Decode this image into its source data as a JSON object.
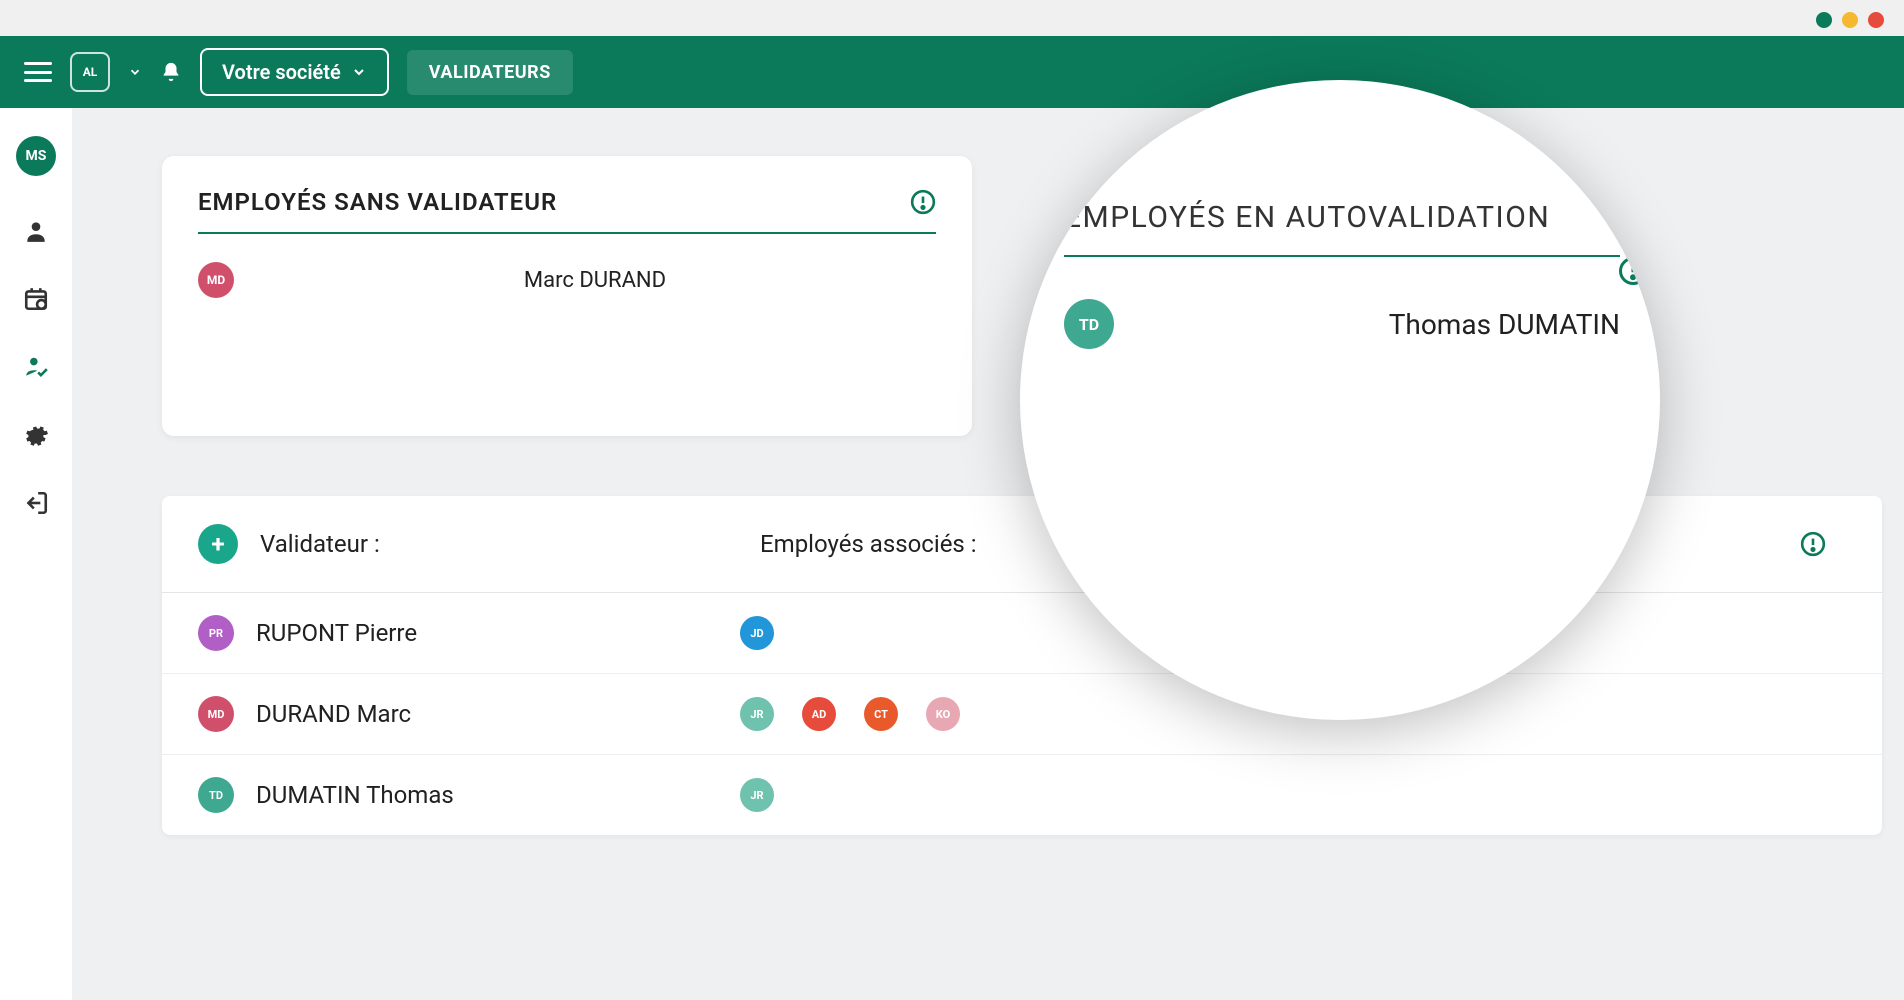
{
  "window": {
    "controls": [
      "green",
      "yellow",
      "red"
    ]
  },
  "topbar": {
    "logo": "AL",
    "company_label": "Votre société",
    "tab_label": "VALIDATEURS"
  },
  "sidebar": {
    "user_avatar": "MS"
  },
  "cards": {
    "no_validator": {
      "title": "EMPLOYÉS SANS VALIDATEUR",
      "employees": [
        {
          "initials": "MD",
          "name": "Marc DURAND"
        }
      ]
    },
    "autovalidation": {
      "title": "EMPLOYÉS EN AUTOVALIDATION",
      "employees": [
        {
          "initials": "TD",
          "name": "Thomas DUMATIN"
        }
      ]
    }
  },
  "validator_table": {
    "col_validator": "Validateur :",
    "col_employees": "Employés associés :",
    "rows": [
      {
        "initials": "PR",
        "name": "RUPONT Pierre",
        "employees": [
          {
            "initials": "JD",
            "cls": "c-jd"
          }
        ]
      },
      {
        "initials": "MD",
        "name": "DURAND Marc",
        "employees": [
          {
            "initials": "JR",
            "cls": "c-jr"
          },
          {
            "initials": "AD",
            "cls": "c-ad"
          },
          {
            "initials": "CT",
            "cls": "c-ct"
          },
          {
            "initials": "KO",
            "cls": "c-ko"
          }
        ]
      },
      {
        "initials": "TD",
        "name": "DUMATIN Thomas",
        "employees": [
          {
            "initials": "JR",
            "cls": "c-jr"
          }
        ]
      }
    ]
  }
}
